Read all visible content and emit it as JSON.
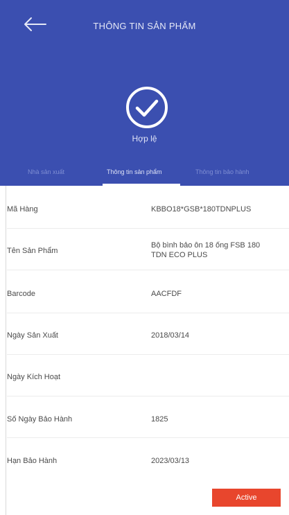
{
  "header": {
    "title": "THÔNG TIN SẢN PHẨM",
    "status": "Hợp lệ",
    "tabs": [
      {
        "label": "Nhà sản xuất",
        "active": false
      },
      {
        "label": "Thông tin sản phẩm",
        "active": true
      },
      {
        "label": "Thông tin bảo hành",
        "active": false
      }
    ]
  },
  "rows": [
    {
      "label": "Mã Hàng",
      "value": "KBBO18*GSB*180TDNPLUS",
      "value2": ""
    },
    {
      "label": "Tên Sản Phẩm",
      "value": "Bộ bình bảo ôn 18 ống FSB 180",
      "value2": "TDN ECO PLUS"
    },
    {
      "label": "Barcode",
      "value": "AACFDF",
      "value2": ""
    },
    {
      "label": "Ngày Sản Xuất",
      "value": "2018/03/14",
      "value2": ""
    },
    {
      "label": "Ngày Kích Hoạt",
      "value": "",
      "value2": ""
    },
    {
      "label": "Số Ngày Bảo Hành",
      "value": "1825",
      "value2": ""
    },
    {
      "label": "Hạn Bảo Hành",
      "value": "2023/03/13",
      "value2": ""
    }
  ],
  "action": {
    "label": "Active"
  },
  "colors": {
    "header": "#3b4fb0",
    "button": "#e8462d"
  },
  "icons": {
    "back": "arrow-left-icon",
    "status": "check-circle-icon"
  }
}
